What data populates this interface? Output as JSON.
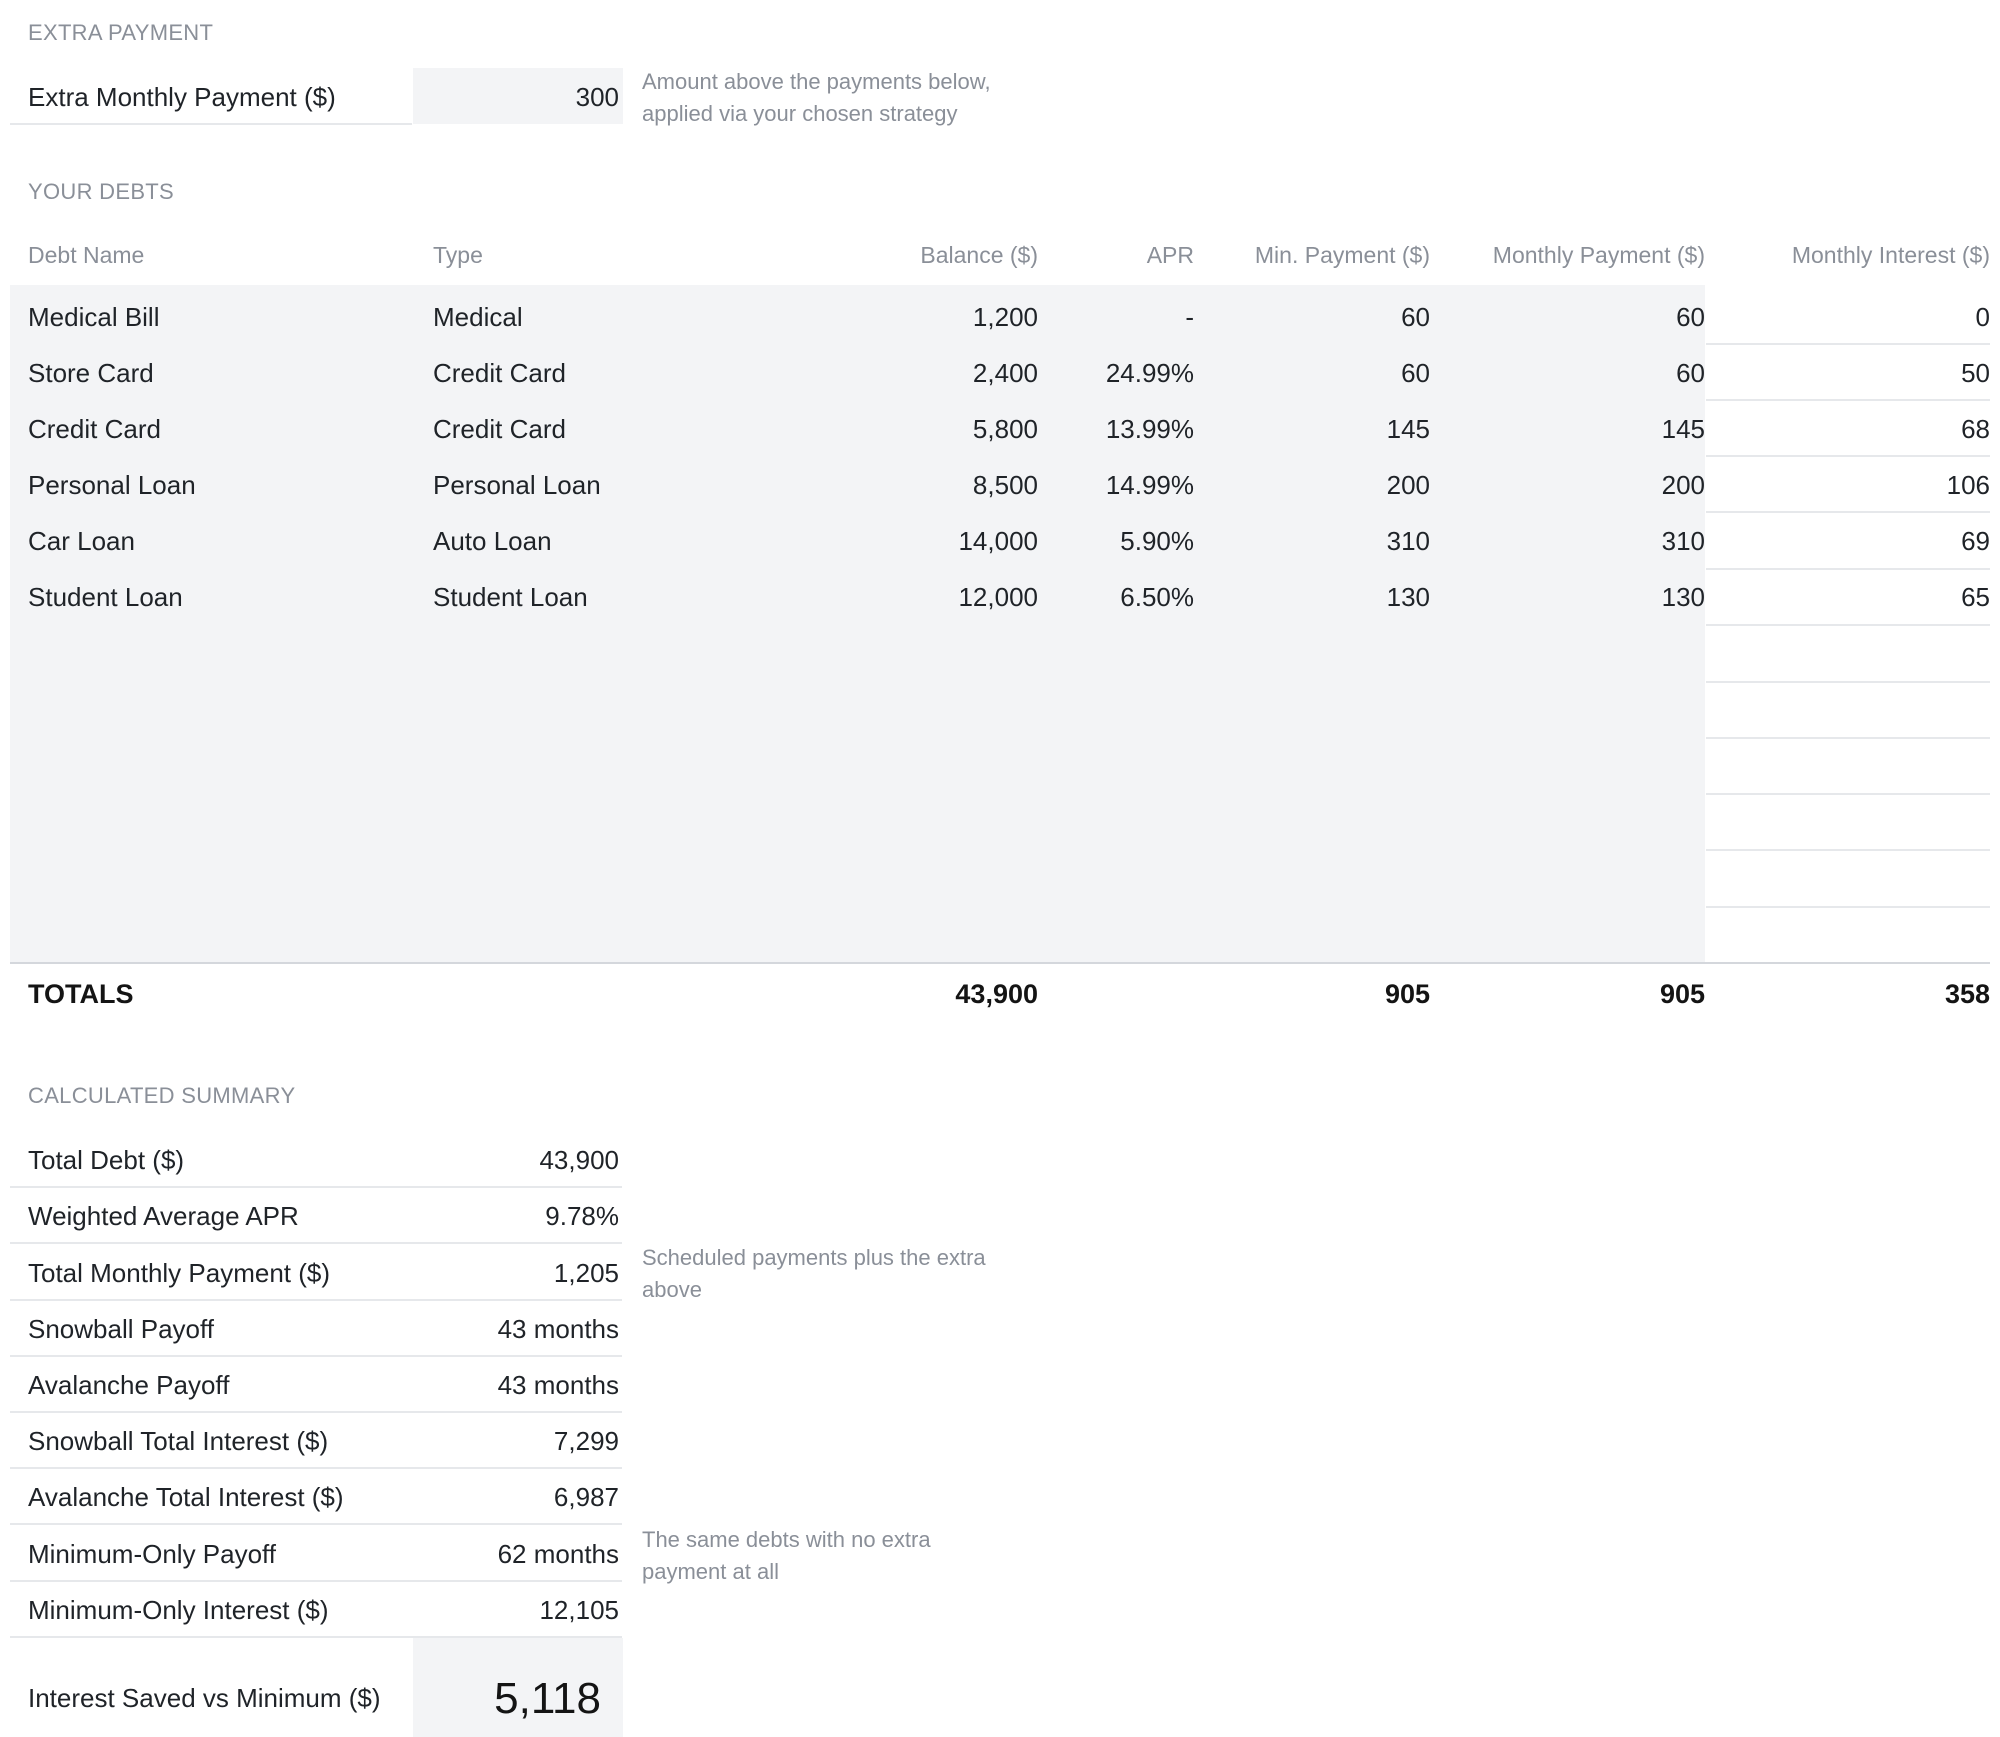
{
  "extra_payment": {
    "section_title": "EXTRA PAYMENT",
    "label": "Extra Monthly Payment ($)",
    "value": "300",
    "note_line1": "Amount above the payments below,",
    "note_line2": "applied via your chosen strategy"
  },
  "debts": {
    "section_title": "YOUR DEBTS",
    "columns": [
      "Debt Name",
      "Type",
      "Balance ($)",
      "APR",
      "Min. Payment ($)",
      "Monthly Payment ($)",
      "Monthly Interest ($)"
    ],
    "rows": [
      {
        "name": "Medical Bill",
        "type": "Medical",
        "balance": "1,200",
        "apr": "-",
        "min": "60",
        "monthly": "60",
        "interest": "0"
      },
      {
        "name": "Store Card",
        "type": "Credit Card",
        "balance": "2,400",
        "apr": "24.99%",
        "min": "60",
        "monthly": "60",
        "interest": "50"
      },
      {
        "name": "Credit Card",
        "type": "Credit Card",
        "balance": "5,800",
        "apr": "13.99%",
        "min": "145",
        "monthly": "145",
        "interest": "68"
      },
      {
        "name": "Personal Loan",
        "type": "Personal Loan",
        "balance": "8,500",
        "apr": "14.99%",
        "min": "200",
        "monthly": "200",
        "interest": "106"
      },
      {
        "name": "Car Loan",
        "type": "Auto Loan",
        "balance": "14,000",
        "apr": "5.90%",
        "min": "310",
        "monthly": "310",
        "interest": "69"
      },
      {
        "name": "Student Loan",
        "type": "Student Loan",
        "balance": "12,000",
        "apr": "6.50%",
        "min": "130",
        "monthly": "130",
        "interest": "65"
      }
    ],
    "totals": {
      "label": "TOTALS",
      "balance": "43,900",
      "min": "905",
      "monthly": "905",
      "interest": "358"
    }
  },
  "summary": {
    "section_title": "CALCULATED SUMMARY",
    "rows": [
      {
        "label": "Total Debt ($)",
        "value": "43,900"
      },
      {
        "label": "Weighted Average APR",
        "value": "9.78%"
      },
      {
        "label": "Total Monthly Payment ($)",
        "value": "1,205"
      },
      {
        "label": "Snowball Payoff",
        "value": "43 months"
      },
      {
        "label": "Avalanche Payoff",
        "value": "43 months"
      },
      {
        "label": "Snowball Total Interest ($)",
        "value": "7,299"
      },
      {
        "label": "Avalanche Total Interest ($)",
        "value": "6,987"
      },
      {
        "label": "Minimum-Only Payoff",
        "value": "62 months"
      },
      {
        "label": "Minimum-Only Interest ($)",
        "value": "12,105"
      }
    ],
    "note_payment_line1": "Scheduled payments plus the extra",
    "note_payment_line2": "above",
    "note_minimum_line1": "The same debts with no extra",
    "note_minimum_line2": "payment at all",
    "saved_label": "Interest Saved vs Minimum ($)",
    "saved_value": "5,118"
  }
}
